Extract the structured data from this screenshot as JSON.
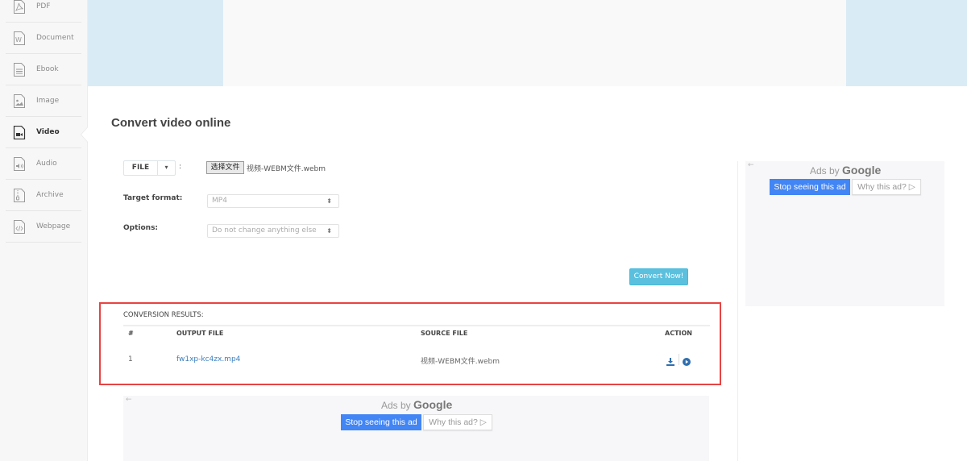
{
  "sidebar": {
    "items": [
      {
        "label": "PDF",
        "icon": "pdf-icon"
      },
      {
        "label": "Document",
        "icon": "document-icon"
      },
      {
        "label": "Ebook",
        "icon": "ebook-icon"
      },
      {
        "label": "Image",
        "icon": "image-icon"
      },
      {
        "label": "Video",
        "icon": "video-icon",
        "active": true
      },
      {
        "label": "Audio",
        "icon": "audio-icon"
      },
      {
        "label": "Archive",
        "icon": "archive-icon"
      },
      {
        "label": "Webpage",
        "icon": "webpage-icon"
      }
    ]
  },
  "page": {
    "title": "Convert video online"
  },
  "form": {
    "source_type": "FILE",
    "source_caret": "▾",
    "colon": ":",
    "choose_file_label": "选择文件",
    "chosen_file": "视频-WEBM文件.webm",
    "target_format_label": "Target format:",
    "target_format_value": "MP4",
    "options_label": "Options:",
    "options_value": "Do not change anything else",
    "select_arrow": "⬍",
    "convert_label": "Convert Now!"
  },
  "results": {
    "title": "CONVERSION RESULTS:",
    "headers": [
      "#",
      "OUTPUT FILE",
      "SOURCE FILE",
      "ACTION"
    ],
    "rows": [
      {
        "index": "1",
        "output_file": "fw1xp-kc4zx.mp4",
        "source_file": "视频-WEBM文件.webm"
      }
    ]
  },
  "ads": {
    "back": "←",
    "ads_by": "Ads by",
    "google": "Google",
    "stop_label": "Stop seeing this ad",
    "why_label": "Why this ad? ▷"
  },
  "colors": {
    "accent": "#5bc0de",
    "link": "#3a7fc1",
    "highlight_border": "#e84343",
    "google_blue": "#4285f4",
    "banner": "#d9ebf5"
  }
}
